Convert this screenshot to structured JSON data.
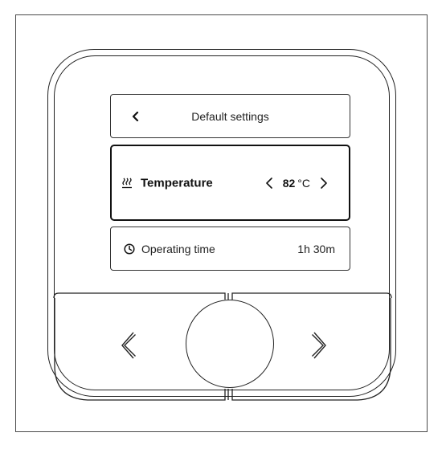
{
  "screen": {
    "header": {
      "title": "Default settings",
      "back_icon": "chevron-left-icon"
    },
    "temperature_row": {
      "icon": "heating-icon",
      "label": "Temperature",
      "value": "82",
      "unit": "°C",
      "decrease_icon": "chevron-left-icon",
      "increase_icon": "chevron-right-icon"
    },
    "operating_time_row": {
      "icon": "clock-icon",
      "label": "Operating time",
      "value": "1h 30m"
    }
  },
  "controls": {
    "left_button_icon": "chevron-left-icon",
    "right_button_icon": "chevron-right-icon",
    "center_knob": "knob"
  },
  "colors": {
    "line": "#222222",
    "background": "#ffffff",
    "text": "#111111"
  }
}
